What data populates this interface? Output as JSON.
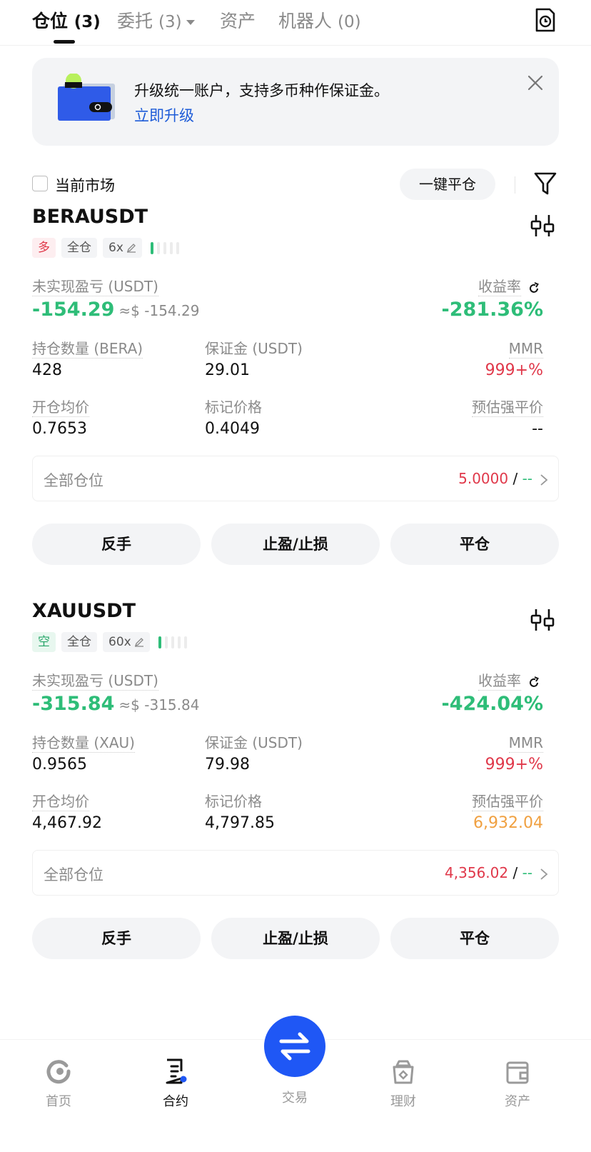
{
  "tabs": [
    {
      "label": "仓位",
      "count": "(3)"
    },
    {
      "label": "委托",
      "count": "(3)"
    },
    {
      "label": "资产",
      "count": ""
    },
    {
      "label": "机器人",
      "count": "(0)"
    }
  ],
  "banner": {
    "title": "升级统一账户，支持多币种作保证金。",
    "link": "立即升级"
  },
  "filter": {
    "checkbox_label": "当前市场",
    "close_all": "一键平仓"
  },
  "labels": {
    "unrealized_pnl": "未实现盈亏 (USDT)",
    "roe": "收益率",
    "margin": "保证金 (USDT)",
    "mmr": "MMR",
    "entry_price": "开仓均价",
    "mark_price": "标记价格",
    "liq_price": "预估强平价",
    "all_positions": "全部仓位",
    "reverse": "反手",
    "tpsl": "止盈/止损",
    "close": "平仓"
  },
  "positions": [
    {
      "symbol": "BERAUSDT",
      "side": "多",
      "margin_mode": "全仓",
      "leverage": "6x",
      "pnl": "-154.29",
      "pnl_approx": "≈$ -154.29",
      "roe": "-281.36%",
      "qty_label": "持仓数量 (BERA)",
      "qty": "428",
      "margin": "29.01",
      "mmr": "999+%",
      "entry_price": "0.7653",
      "mark_price": "0.4049",
      "liq_price": "--",
      "all_pos_value": "5.0000",
      "all_pos_sep": " / ",
      "all_pos_dash": "--"
    },
    {
      "symbol": "XAUUSDT",
      "side": "空",
      "margin_mode": "全仓",
      "leverage": "60x",
      "pnl": "-315.84",
      "pnl_approx": "≈$ -315.84",
      "roe": "-424.04%",
      "qty_label": "持仓数量 (XAU)",
      "qty": "0.9565",
      "margin": "79.98",
      "mmr": "999+%",
      "entry_price": "4,467.92",
      "mark_price": "4,797.85",
      "liq_price": "6,932.04",
      "all_pos_value": "4,356.02",
      "all_pos_sep": " / ",
      "all_pos_dash": "--"
    }
  ],
  "nav": {
    "home": "首页",
    "contract": "合约",
    "trade": "交易",
    "earn": "理财",
    "assets": "资产"
  },
  "colors": {
    "green": "#2ebd78",
    "red": "#e0384a",
    "orange": "#f0a040",
    "brand_blue": "#1f57f5",
    "link_blue": "#1e5cd8"
  }
}
